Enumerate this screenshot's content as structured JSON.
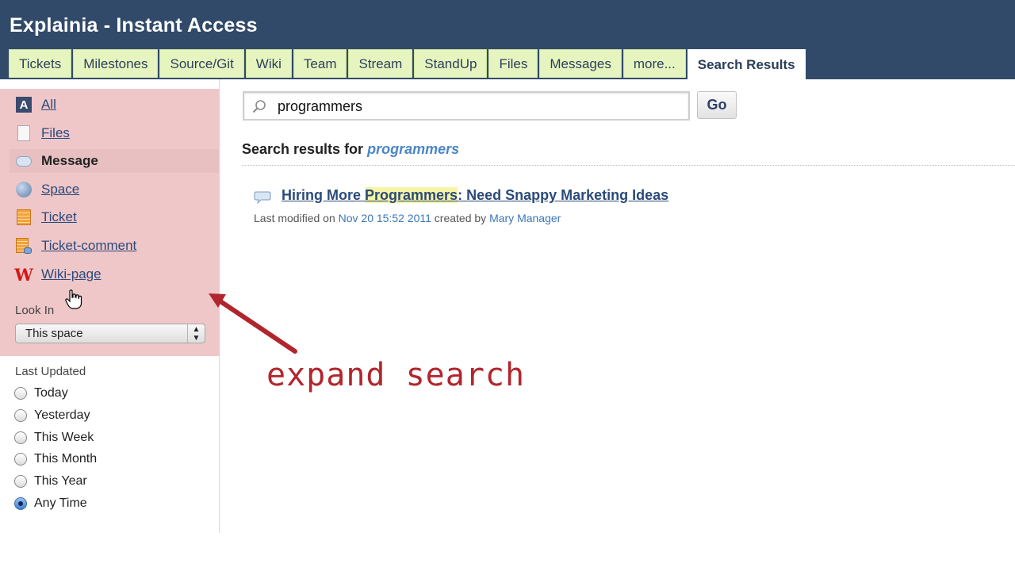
{
  "app": {
    "title": "Explainia - Instant Access"
  },
  "tabs": [
    {
      "label": "Tickets"
    },
    {
      "label": "Milestones"
    },
    {
      "label": "Source/Git"
    },
    {
      "label": "Wiki"
    },
    {
      "label": "Team"
    },
    {
      "label": "Stream"
    },
    {
      "label": "StandUp"
    },
    {
      "label": "Files"
    },
    {
      "label": "Messages"
    },
    {
      "label": "more..."
    },
    {
      "label": "Search Results",
      "active": true
    }
  ],
  "sidebar": {
    "types": [
      {
        "label": "All",
        "icon": "all-icon"
      },
      {
        "label": "Files",
        "icon": "file-icon"
      },
      {
        "label": "Message",
        "icon": "message-icon",
        "selected": true
      },
      {
        "label": "Space",
        "icon": "space-icon"
      },
      {
        "label": "Ticket",
        "icon": "ticket-icon"
      },
      {
        "label": "Ticket-comment",
        "icon": "ticket-comment-icon"
      },
      {
        "label": "Wiki-page",
        "icon": "wiki-icon"
      }
    ],
    "look_in": {
      "label": "Look In",
      "selected": "This space"
    },
    "last_updated": {
      "label": "Last Updated",
      "options": [
        "Today",
        "Yesterday",
        "This Week",
        "This Month",
        "This Year",
        "Any Time"
      ],
      "selected": "Any Time"
    }
  },
  "search": {
    "query": "programmers",
    "go_label": "Go"
  },
  "results": {
    "heading": "Search results for",
    "term": "programmers",
    "items": [
      {
        "title_pre": "Hiring More ",
        "title_hl": "Programmers",
        "title_post": ": Need Snappy Marketing Ideas",
        "meta_1": "Last modified on",
        "date": "Nov 20 15:52 2011",
        "meta_2": "created by",
        "author": "Mary Manager"
      }
    ]
  },
  "annotation": {
    "text": "expand search",
    "color": "#b1262d"
  },
  "colors": {
    "header_bg": "#324a69",
    "tab_bg": "#e6f5bf",
    "sidebar_highlight": "#efc7c9",
    "link": "#2b4a7a"
  }
}
